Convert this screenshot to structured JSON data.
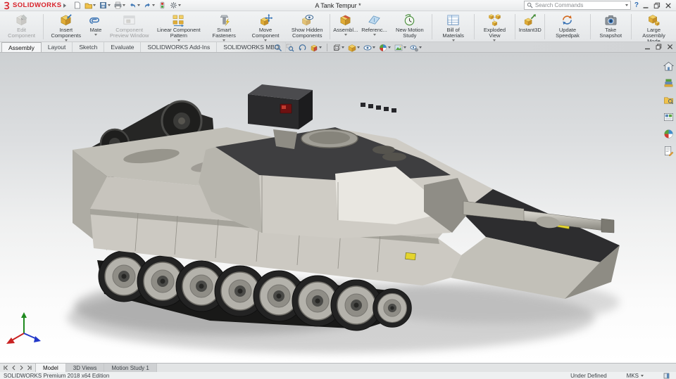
{
  "title_bar": {
    "logo_text": "SOLIDWORKS",
    "document_title": "A Tank Tempur *",
    "search_placeholder": "Search Commands"
  },
  "icons": {
    "help": "?"
  },
  "ribbon": {
    "commands": [
      {
        "label": "Edit Component"
      },
      {
        "label": "Insert Components"
      },
      {
        "label": "Mate"
      },
      {
        "label": "Component Preview Window"
      },
      {
        "label": "Linear Component Pattern"
      },
      {
        "label": "Smart Fasteners"
      },
      {
        "label": "Move Component"
      },
      {
        "label": "Show Hidden Components"
      },
      {
        "label": "Assembl..."
      },
      {
        "label": "Referenc..."
      },
      {
        "label": "New Motion Study"
      },
      {
        "label": "Bill of Materials"
      },
      {
        "label": "Exploded View"
      },
      {
        "label": "Instant3D"
      },
      {
        "label": "Update Speedpak"
      },
      {
        "label": "Take Snapshot"
      },
      {
        "label": "Large Assembly Mode"
      }
    ]
  },
  "command_tabs": [
    {
      "label": "Assembly"
    },
    {
      "label": "Layout"
    },
    {
      "label": "Sketch"
    },
    {
      "label": "Evaluate"
    },
    {
      "label": "SOLIDWORKS Add-Ins"
    },
    {
      "label": "SOLIDWORKS MBD"
    }
  ],
  "bottom_tabs": [
    {
      "label": "Model"
    },
    {
      "label": "3D Views"
    },
    {
      "label": "Motion Study 1"
    }
  ],
  "status_bar": {
    "edition": "SOLIDWORKS Premium 2018 x64 Edition",
    "constraint_state": "Under Defined",
    "units": "MKS"
  }
}
